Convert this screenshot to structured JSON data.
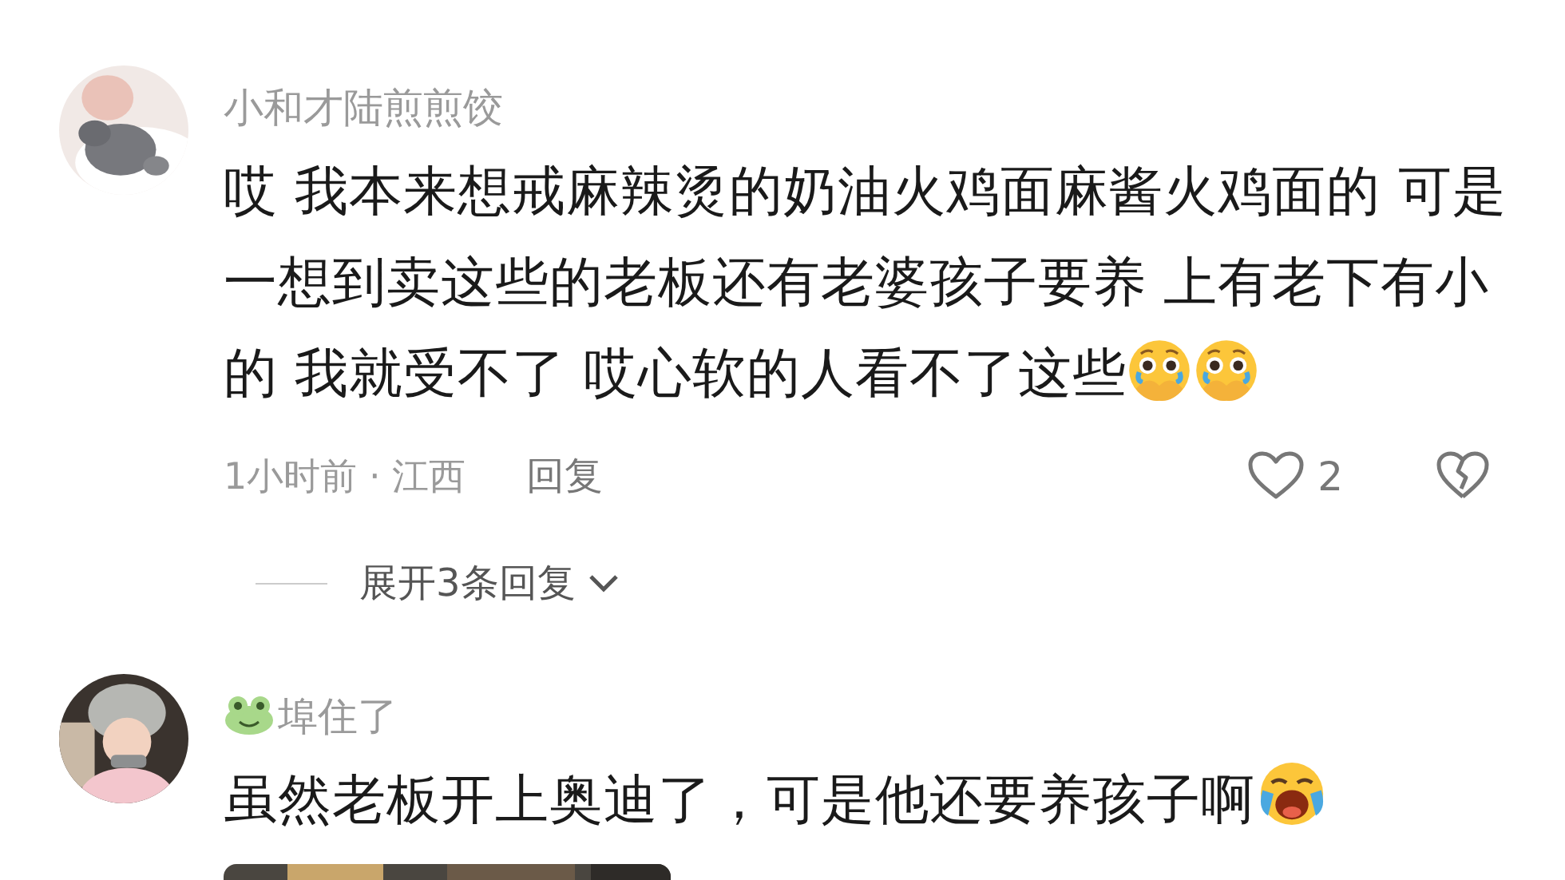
{
  "comments": [
    {
      "name": "小和才陆煎煎饺",
      "text": "哎 我本来想戒麻辣烫的奶油火鸡面麻酱火鸡面的 可是一想到卖这些的老板还有老婆孩子要养 上有老下有小的 我就受不了 哎心软的人看不了这些",
      "emojis": [
        {
          "kind": "covered-crying"
        },
        {
          "kind": "covered-crying"
        }
      ],
      "time": "1小时前 · 江西",
      "reply": "回复",
      "likes": "2",
      "liked": false,
      "expand": "展开3条回复",
      "has_picture": false
    },
    {
      "name": "埠住了",
      "badge": {
        "kind": "frog"
      },
      "text": "虽然老板开上奥迪了，可是他还要养孩子啊",
      "emojis": [
        {
          "kind": "loud-crying"
        }
      ],
      "has_picture": true
    }
  ]
}
